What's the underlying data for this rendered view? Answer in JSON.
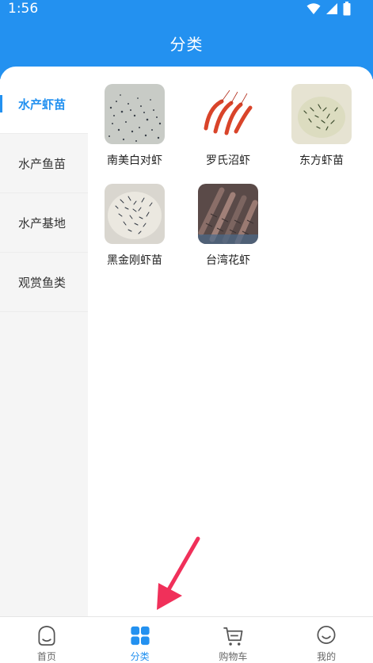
{
  "status_bar": {
    "time": "1:56"
  },
  "header": {
    "title": "分类"
  },
  "sidebar": {
    "items": [
      {
        "label": "水产虾苗",
        "active": true
      },
      {
        "label": "水产鱼苗",
        "active": false
      },
      {
        "label": "水产基地",
        "active": false
      },
      {
        "label": "观赏鱼类",
        "active": false
      }
    ]
  },
  "products": [
    {
      "label": "南美白对虾",
      "image": "shrimp-larvae-tank-photo"
    },
    {
      "label": "罗氏沼虾",
      "image": "cooked-red-shrimp-photo"
    },
    {
      "label": "东方虾苗",
      "image": "shrimp-fry-bowl-photo"
    },
    {
      "label": "黑金刚虾苗",
      "image": "shrimp-fry-basin-photo"
    },
    {
      "label": "台湾花虾",
      "image": "striped-prawns-photo"
    }
  ],
  "tabbar": {
    "items": [
      {
        "label": "首页",
        "icon": "home-face-icon",
        "active": false
      },
      {
        "label": "分类",
        "icon": "category-grid-icon",
        "active": true
      },
      {
        "label": "购物车",
        "icon": "cart-icon",
        "active": false
      },
      {
        "label": "我的",
        "icon": "profile-smile-icon",
        "active": false
      }
    ]
  },
  "colors": {
    "accent": "#2391f0",
    "sidebar_bg": "#f5f5f5",
    "annotation_arrow": "#f0305a"
  }
}
